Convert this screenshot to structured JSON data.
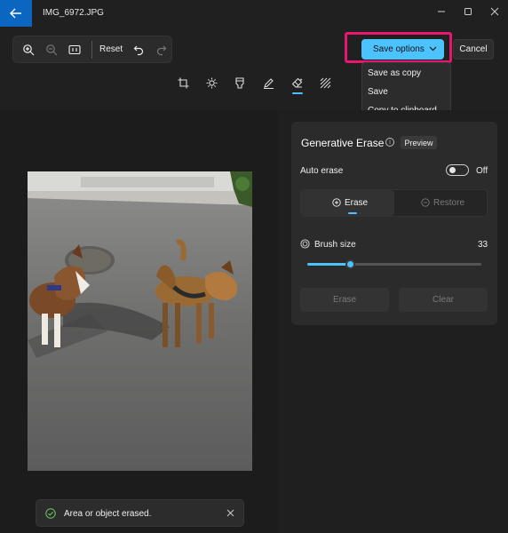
{
  "window": {
    "title": "IMG_6972.JPG"
  },
  "zoombar": {
    "reset_label": "Reset",
    "icons": [
      "zoom-in-icon",
      "zoom-out-icon",
      "actual-size-icon",
      "undo-icon",
      "redo-icon"
    ]
  },
  "actions": {
    "save_label": "Save options",
    "cancel_label": "Cancel"
  },
  "save_menu": {
    "items": [
      "Save as copy",
      "Save",
      "Copy to clipboard"
    ]
  },
  "tools": [
    "crop-icon",
    "adjust-icon",
    "filter-icon",
    "markup-icon",
    "erase-icon",
    "background-icon"
  ],
  "panel": {
    "title": "Generative Erase",
    "badge": "Preview",
    "auto_erase_label": "Auto erase",
    "auto_erase_state": "Off",
    "modes": {
      "erase": "Erase",
      "restore": "Restore"
    },
    "brush_label": "Brush size",
    "brush_value": "33",
    "brush_fraction": 0.25,
    "erase_button": "Erase",
    "clear_button": "Clear"
  },
  "toast": {
    "message": "Area or object erased."
  },
  "colors": {
    "accent": "#4cc2ff",
    "highlight": "#e8166f",
    "titlebar_back": "#0b66c2"
  }
}
